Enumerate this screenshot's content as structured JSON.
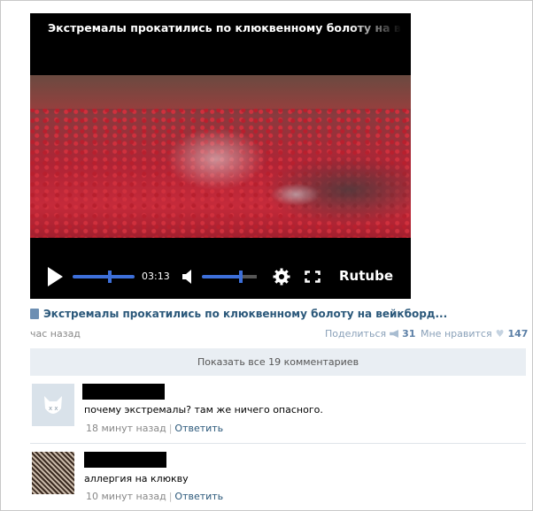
{
  "player": {
    "title": "Экстремалы прокатились по клюквенному болоту на ве",
    "time": "03:13",
    "brand": "Rutube"
  },
  "post": {
    "video_title": "Экстремалы прокатились по клюквенному болоту на вейкборд...",
    "posted": "час назад",
    "share_label": "Поделиться",
    "share_count": "31",
    "like_label": "Мне нравится",
    "like_count": "147",
    "show_all": "Показать все 19 комментариев"
  },
  "comments": [
    {
      "text": "почему экстремалы? там же ничего опасного.",
      "time": "18 минут назад",
      "reply": "Ответить",
      "avatar": "default-avatar-icon"
    },
    {
      "text": "аллергия на клюкву",
      "time": "10 минут назад",
      "reply": "Ответить",
      "avatar": "photo"
    }
  ],
  "colors": {
    "link": "#2b587a",
    "accent": "#3d6fd9",
    "bar": "#e9eef3"
  }
}
